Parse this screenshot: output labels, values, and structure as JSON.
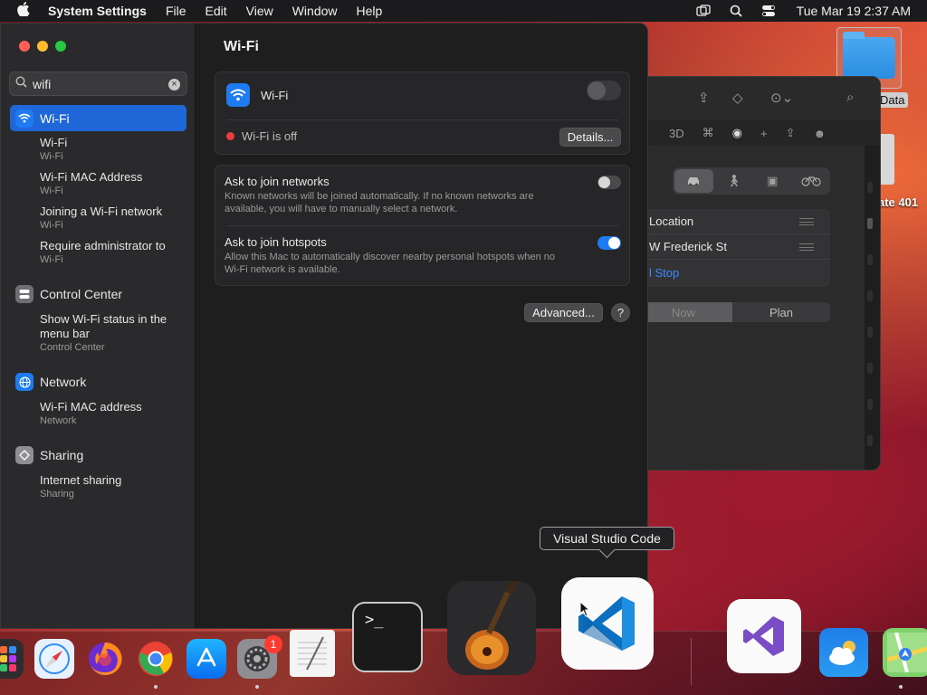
{
  "menubar": {
    "app_name": "System Settings",
    "menus": [
      "File",
      "Edit",
      "View",
      "Window",
      "Help"
    ],
    "clock": "Tue Mar 19  2:37 AM"
  },
  "maps_window": {
    "transport_modes": [
      "car-icon",
      "walk-icon",
      "transit-icon",
      "bike-icon"
    ],
    "route": [
      "Location",
      "W Frederick St",
      "l Stop"
    ],
    "segment": [
      "Now",
      "Plan"
    ],
    "toolbar_3d": "3D"
  },
  "desktop": {
    "folder_label": "Data",
    "item2_label": "ate 401"
  },
  "sidebar": {
    "search_value": "wifi",
    "selected": "Wi-Fi",
    "groups": [
      {
        "label": "Wi-Fi",
        "results": [
          {
            "title": "Wi-Fi",
            "sub": "Wi-Fi"
          },
          {
            "title": "Wi-Fi MAC Address",
            "sub": "Wi-Fi"
          },
          {
            "title": "Joining a Wi-Fi network",
            "sub": "Wi-Fi"
          },
          {
            "title": "Require administrator to",
            "sub": "Wi-Fi"
          }
        ]
      },
      {
        "label": "Control Center",
        "results": [
          {
            "title": "Show Wi-Fi status in the menu bar",
            "sub": "Control Center"
          }
        ]
      },
      {
        "label": "Network",
        "results": [
          {
            "title": "Wi-Fi MAC address",
            "sub": "Network"
          }
        ]
      },
      {
        "label": "Sharing",
        "results": [
          {
            "title": "Internet sharing",
            "sub": "Sharing"
          }
        ]
      }
    ]
  },
  "content": {
    "title": "Wi-Fi",
    "wifi_label": "Wi-Fi",
    "wifi_enabled": false,
    "status": "Wi-Fi is off",
    "details_button": "Details...",
    "ask_networks_title": "Ask to join networks",
    "ask_networks_desc": "Known networks will be joined automatically. If no known networks are available, you will have to manually select a network.",
    "ask_networks_on": false,
    "ask_hotspots_title": "Ask to join hotspots",
    "ask_hotspots_desc": "Allow this Mac to automatically discover nearby personal hotspots when no Wi-Fi network is available.",
    "ask_hotspots_on": true,
    "advanced_button": "Advanced...",
    "help_button": "?"
  },
  "tooltip": "Visual Studio Code",
  "dock": {
    "settings_badge": "1",
    "terminal_prompt": ">_"
  },
  "colors": {
    "accent": "#1f66d9",
    "toggle_on": "#1f7bf2",
    "status_off": "#ee3b3b"
  }
}
